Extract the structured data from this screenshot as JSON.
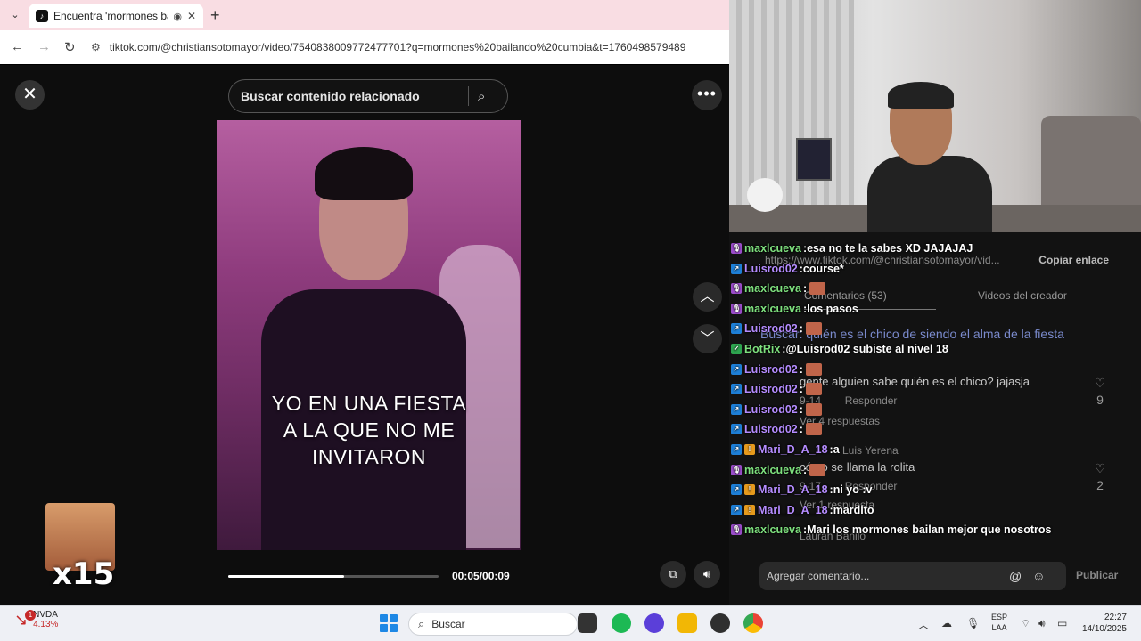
{
  "browser": {
    "tab_title": "Encuentra 'mormones baila",
    "url": "tiktok.com/@christiansotomayor/video/7540838009772477701?q=mormones%20bailando%20cumbia&t=1760498579489"
  },
  "viewer": {
    "search_placeholder": "Buscar contenido relacionado",
    "caption_line1": "YO EN UNA FIESTA",
    "caption_line2": "A LA QUE NO ME",
    "caption_line3": "INVITARON",
    "time": "00:05/00:09",
    "progress": 0.55,
    "emote_multiplier": "x15"
  },
  "panel": {
    "share_url": "https://www.tiktok.com/@christiansotomayor/vid...",
    "copy_label": "Copiar enlace",
    "tab_comments": "Comentarios (53)",
    "tab_videos": "Videos del creador",
    "search_hint": "Buscar: quién es el chico de siendo el alma de la fiesta",
    "comments": [
      {
        "text": "gente alguien sabe quién es el chico? jajasja",
        "date": "9-14",
        "reply": "Responder",
        "likes": "9",
        "view_replies": "Ver 4 respuestas"
      },
      {
        "author": "Luis Yerena",
        "text": "cómo se llama la rolita",
        "date": "9-17",
        "reply": "Responder",
        "likes": "2",
        "view_replies": "Ver 1 respuesta"
      },
      {
        "author": "Laurah Banilo"
      }
    ],
    "comment_placeholder": "Agregar comentario...",
    "publish_label": "Publicar"
  },
  "chat": [
    {
      "user": "maxlcueva",
      "color": "#7ee07e",
      "badge": "mic",
      "msg": "esa no te la sabes XD JAJAJAJ"
    },
    {
      "user": "Luisrod02",
      "color": "#b58cff",
      "badge": "prime",
      "msg": "course*"
    },
    {
      "user": "maxlcueva",
      "color": "#7ee07e",
      "badge": "mic",
      "msg": "",
      "emote": true
    },
    {
      "user": "maxlcueva",
      "color": "#7ee07e",
      "badge": "mic",
      "msg": "los pasos"
    },
    {
      "user": "Luisrod02",
      "color": "#b58cff",
      "badge": "prime",
      "msg": "",
      "emote": true
    },
    {
      "user": "BotRix",
      "color": "#7ee07e",
      "badge": "bot",
      "msg": "@Luisrod02 subiste al nivel 18"
    },
    {
      "user": "Luisrod02",
      "color": "#b58cff",
      "badge": "prime",
      "msg": "",
      "emote": true
    },
    {
      "user": "Luisrod02",
      "color": "#b58cff",
      "badge": "prime",
      "msg": "",
      "emote": true
    },
    {
      "user": "Luisrod02",
      "color": "#b58cff",
      "badge": "prime",
      "msg": "",
      "emote": true
    },
    {
      "user": "Luisrod02",
      "color": "#b58cff",
      "badge": "prime",
      "msg": "",
      "emote": true
    },
    {
      "user": "Mari_D_A_18",
      "color": "#b58cff",
      "badge": "multi",
      "msg": "a"
    },
    {
      "user": "maxlcueva",
      "color": "#7ee07e",
      "badge": "mic",
      "msg": "",
      "emote": true
    },
    {
      "user": "Mari_D_A_18",
      "color": "#b58cff",
      "badge": "multi",
      "msg": "ni yo :v"
    },
    {
      "user": "Mari_D_A_18",
      "color": "#b58cff",
      "badge": "multi",
      "msg": "mardito"
    },
    {
      "user": "maxlcueva",
      "color": "#7ee07e",
      "badge": "mic",
      "msg": "Mari los mormones bailan mejor que nosotros"
    }
  ],
  "taskbar": {
    "stock_name": "NVDA",
    "stock_change": "4.13%",
    "stock_badge": "1",
    "search_placeholder": "Buscar",
    "lang_top": "ESP",
    "lang_bottom": "LAA",
    "time": "22:27",
    "date": "14/10/2025"
  }
}
